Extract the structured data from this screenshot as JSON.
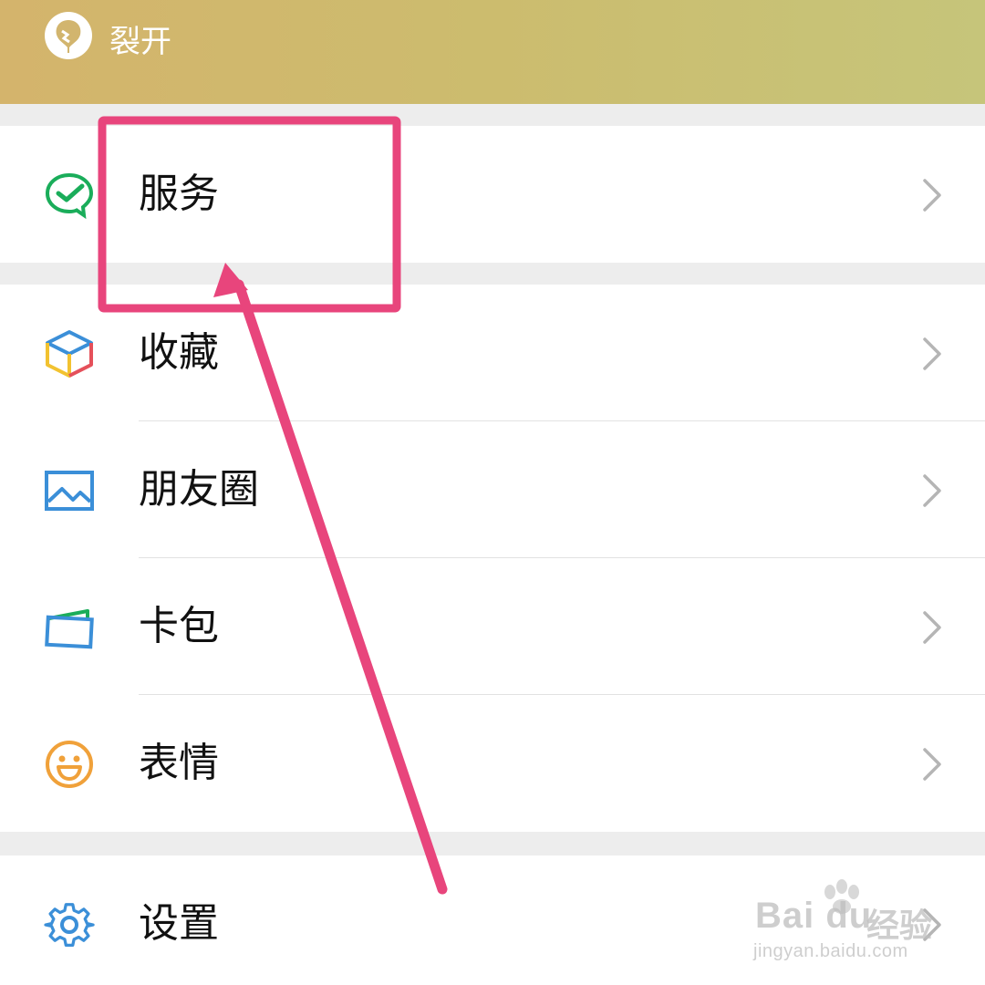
{
  "header": {
    "title": "裂开"
  },
  "menu": {
    "items": [
      {
        "label": "服务",
        "icon": "wechat-pay-icon"
      },
      {
        "label": "收藏",
        "icon": "favorites-cube-icon"
      },
      {
        "label": "朋友圈",
        "icon": "moments-image-icon"
      },
      {
        "label": "卡包",
        "icon": "card-wallet-icon"
      },
      {
        "label": "表情",
        "icon": "smiley-icon"
      },
      {
        "label": "设置",
        "icon": "settings-gear-icon"
      }
    ]
  },
  "annotation": {
    "highlight_color": "#e8457c",
    "target": "服务"
  },
  "watermark": {
    "brand": "Bai du",
    "suffix": "经验",
    "url": "jingyan.baidu.com"
  }
}
